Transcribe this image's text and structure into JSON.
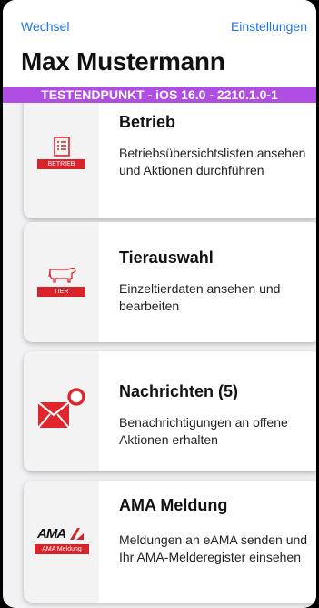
{
  "nav": {
    "left_label": "Wechsel",
    "right_label": "Einstellungen"
  },
  "header": {
    "title": "Max Mustermann"
  },
  "environment_banner": {
    "text": "TESTENDPUNKT - iOS 16.0 - 2210.1.0-1"
  },
  "menu": {
    "items": [
      {
        "title": "Betrieb",
        "description": "Betriebsübersichtslisten ansehen und Aktionen durchführen",
        "icon_name": "list-icon",
        "badge": "BETRIEB"
      },
      {
        "title": "Tierauswahl",
        "description": "Einzeltierdaten ansehen und bearbeiten",
        "icon_name": "cow-icon",
        "badge": "TIER"
      },
      {
        "title": "Nachrichten (5)",
        "description": "Benachrichtigungen an offene Aktionen erhalten",
        "icon_name": "envelope-notification-icon"
      },
      {
        "title": "AMA Meldung",
        "description": "Meldungen an eAMA senden und Ihr AMA-Melderegister einsehen",
        "icon_name": "ama-logo-icon",
        "logo_text": "AMA",
        "badge": "AMA Meldung"
      }
    ]
  },
  "colors": {
    "accent": "#1d74f0",
    "banner": "#b04ee4",
    "brand_red": "#d8232a"
  }
}
